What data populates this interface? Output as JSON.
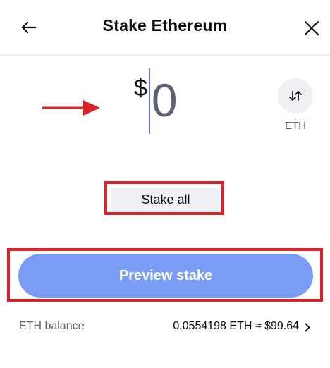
{
  "header": {
    "title": "Stake Ethereum",
    "back_icon": "arrow-left-icon",
    "close_icon": "close-icon"
  },
  "amount": {
    "currency_symbol": "$",
    "value": "0"
  },
  "unit_toggle": {
    "icon": "swap-vertical-icon",
    "label": "ETH"
  },
  "actions": {
    "stake_all_label": "Stake all",
    "preview_label": "Preview stake"
  },
  "balance": {
    "label": "ETH balance",
    "value": "0.0554198 ETH ≈ $99.64"
  },
  "colors": {
    "primary_button": "#7a9cf7",
    "annotation_red": "#d8232a",
    "secondary_button": "#eef0f3",
    "caret": "#5b7cf5"
  }
}
